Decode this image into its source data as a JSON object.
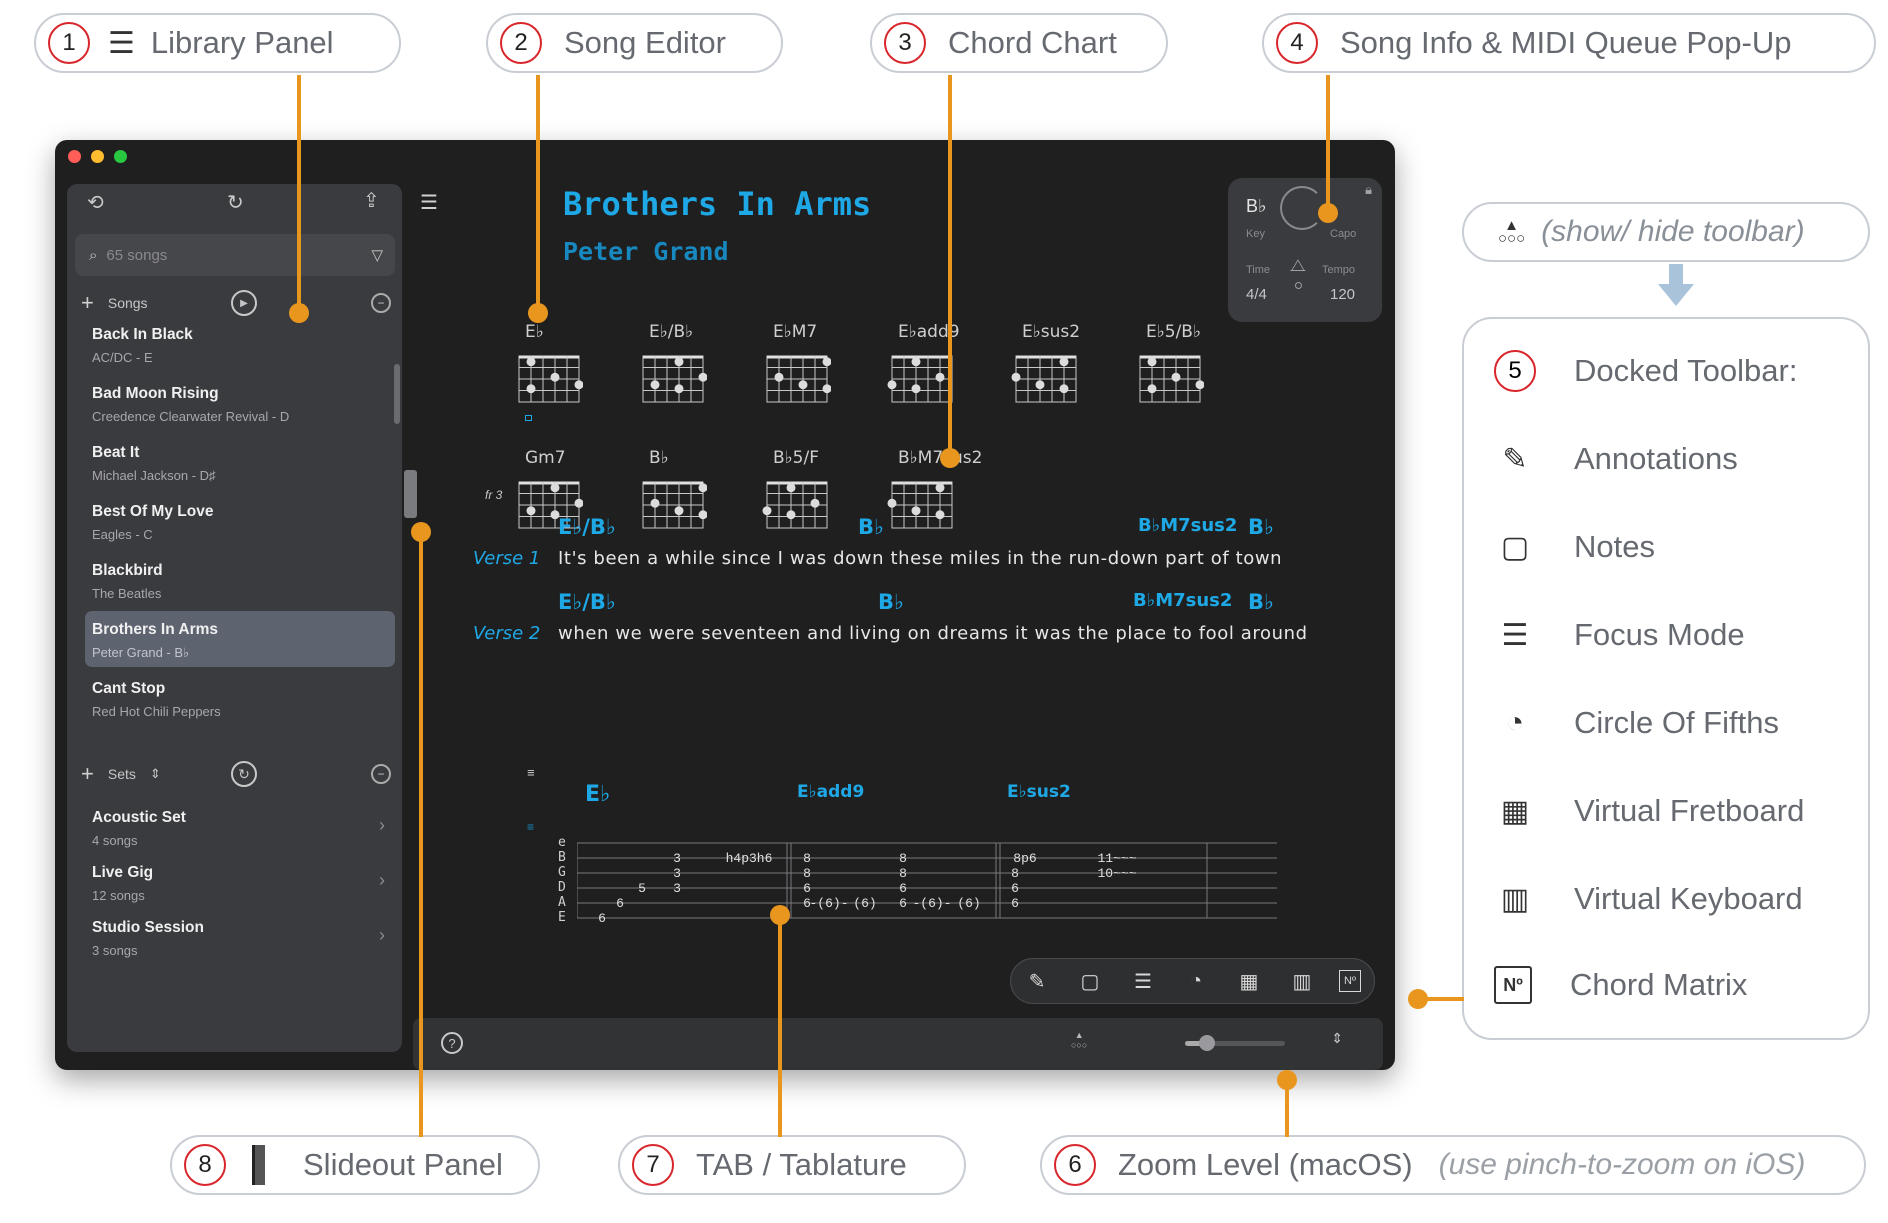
{
  "callouts": {
    "c1": {
      "num": "1",
      "label": "Library Panel"
    },
    "c2": {
      "num": "2",
      "label": "Song Editor"
    },
    "c3": {
      "num": "3",
      "label": "Chord Chart"
    },
    "c4": {
      "num": "4",
      "label": "Song Info & MIDI Queue Pop-Up"
    },
    "c5": {
      "num": "5",
      "label": "Docked Toolbar:"
    },
    "c6": {
      "num": "6",
      "label": "Zoom Level (macOS)",
      "sub": "(use pinch-to-zoom on iOS)"
    },
    "c7": {
      "num": "7",
      "label": "TAB / Tablature"
    },
    "c8": {
      "num": "8",
      "label": "Slideout Panel"
    },
    "toolbar_toggle": {
      "label": "(show/ hide toolbar)"
    }
  },
  "toolbar_items": [
    {
      "label": "Annotations",
      "icon": "annotations-icon"
    },
    {
      "label": "Notes",
      "icon": "notes-icon"
    },
    {
      "label": "Focus Mode",
      "icon": "focus-mode-icon"
    },
    {
      "label": "Circle Of Fifths",
      "icon": "circle-of-fifths-icon"
    },
    {
      "label": "Virtual Fretboard",
      "icon": "virtual-fretboard-icon"
    },
    {
      "label": "Virtual Keyboard",
      "icon": "virtual-keyboard-icon"
    },
    {
      "label": "Chord Matrix",
      "icon": "chord-matrix-icon",
      "glyph": "Nº"
    }
  ],
  "library": {
    "search_placeholder": "65 songs",
    "songs_header": "Songs",
    "sets_header": "Sets",
    "songs": [
      {
        "title": "Back In Black",
        "sub": "AC/DC - E"
      },
      {
        "title": "Bad Moon Rising",
        "sub": "Creedence Clearwater Revival - D"
      },
      {
        "title": "Beat It",
        "sub": "Michael Jackson - D♯"
      },
      {
        "title": "Best Of My Love",
        "sub": "Eagles - C"
      },
      {
        "title": "Blackbird",
        "sub": "The Beatles"
      },
      {
        "title": "Brothers In Arms",
        "sub": "Peter Grand - B♭",
        "selected": true
      },
      {
        "title": "Cant Stop",
        "sub": "Red Hot Chili Peppers"
      }
    ],
    "sets": [
      {
        "title": "Acoustic Set",
        "sub": "4 songs"
      },
      {
        "title": "Live Gig",
        "sub": "12 songs"
      },
      {
        "title": "Studio Session",
        "sub": "3 songs"
      }
    ]
  },
  "song": {
    "title": "Brothers In Arms",
    "artist": "Peter Grand"
  },
  "info_popup": {
    "key": "B♭",
    "key_label": "Key",
    "capo_label": "Capo",
    "time_label": "Time",
    "tempo_label": "Tempo",
    "time": "4/4",
    "tempo": "120"
  },
  "chord_chart": [
    {
      "name": "E♭"
    },
    {
      "name": "E♭/B♭"
    },
    {
      "name": "E♭M7"
    },
    {
      "name": "E♭add9"
    },
    {
      "name": "E♭sus2"
    },
    {
      "name": "E♭5/B♭"
    },
    {
      "name": "Gm7",
      "fret": "fr 3"
    },
    {
      "name": "B♭"
    },
    {
      "name": "B♭5/F"
    },
    {
      "name": "B♭M7sus2"
    }
  ],
  "verses": [
    {
      "label": "Verse 1",
      "lyric": "It's been a while since I was down these miles in the run-down part of town",
      "chords": [
        "E♭/B♭",
        "B♭",
        "B♭M7sus2",
        "B♭"
      ]
    },
    {
      "label": "Verse 2",
      "lyric": "when we were seventeen and living on dreams it was the place to fool around",
      "chords": [
        "E♭/B♭",
        "B♭",
        "B♭M7sus2",
        "B♭"
      ]
    }
  ],
  "tab": {
    "chords": [
      "E♭",
      "E♭add9",
      "E♭sus2"
    ],
    "strings": [
      "e",
      "B",
      "G",
      "D",
      "A",
      "E"
    ]
  },
  "colors": {
    "accent": "#1ea9e6",
    "callout_line": "#e8961e",
    "callout_num_border": "#d8262b"
  }
}
